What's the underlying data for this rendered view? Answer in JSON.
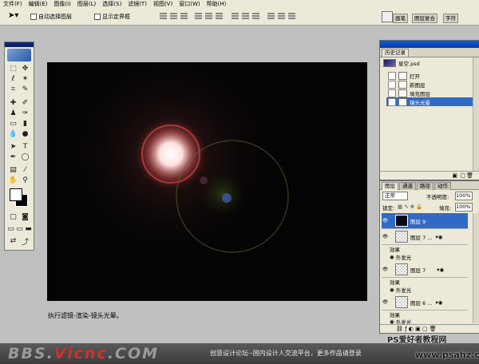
{
  "menu": [
    "文件(F)",
    "编辑(E)",
    "图像(I)",
    "图层(L)",
    "选择(S)",
    "滤镜(T)",
    "视图(V)",
    "窗口(W)",
    "帮助(H)"
  ],
  "options": {
    "auto_select": "自动选择图层",
    "show_bounds": "显示定界框"
  },
  "workspace_tabs": [
    "画笔",
    "图层复合",
    "字符"
  ],
  "history": {
    "tabs": [
      "历史记录"
    ],
    "snapshot": "星空.psd",
    "items": [
      "打开",
      "新图层",
      "填充图层",
      "镜头光晕"
    ],
    "selected": 3
  },
  "layers": {
    "tabs": [
      "图层",
      "通道",
      "路径",
      "动作"
    ],
    "blend_mode": "正常",
    "opacity_label": "不透明度:",
    "opacity": "100%",
    "lock_label": "锁定:",
    "fill_label": "填充:",
    "fill": "100%",
    "rows": [
      {
        "name": "图层 9",
        "selected": true
      },
      {
        "name": "图层 7 ...",
        "effects_label": "效果",
        "effect": "外发光"
      },
      {
        "name": "图层 7",
        "effects_label": "效果",
        "effect": "外发光"
      },
      {
        "name": "图层 6 ...",
        "effects_label": "效果",
        "effect": "外发光"
      }
    ]
  },
  "caption": "执行滤镜-渲染-镜头光晕。",
  "footer": {
    "brand_prefix": "BBS.",
    "brand_mid": "Vicnc",
    "brand_suffix": ".COM",
    "slogan": "创意设计论坛--国内设计人交流平台，更多作品请登录"
  },
  "watermark": {
    "line1": "PS爱好者教程网",
    "line2": "www.psahz.com"
  },
  "colors": {
    "ui_bg": "#ece9d8",
    "canvas": "#040404",
    "selection": "#316ac5",
    "panel_title": "#0a46c8"
  }
}
